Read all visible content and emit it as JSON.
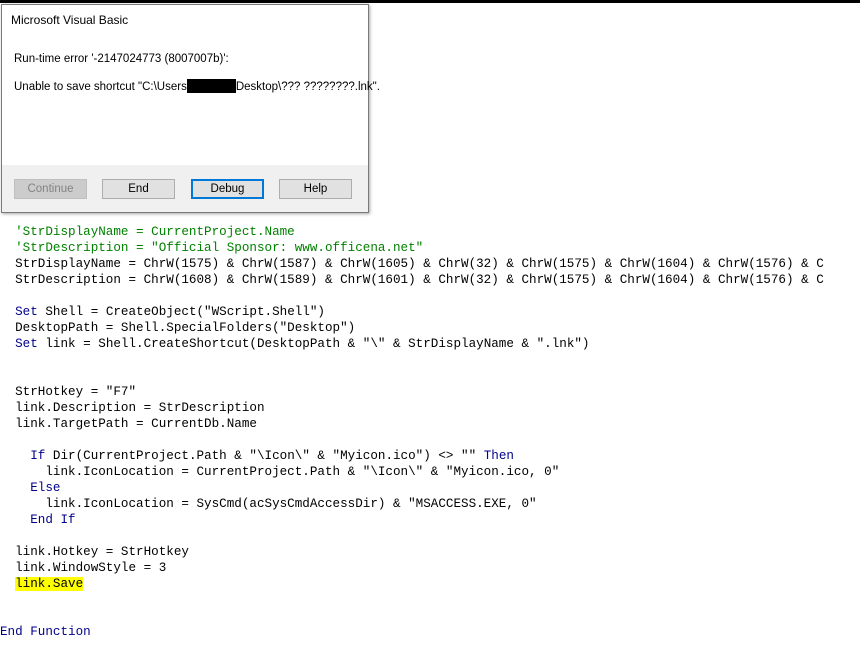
{
  "dialog": {
    "title": "Microsoft Visual Basic",
    "error_line": "Run-time error '-2147024773 (8007007b)':",
    "message_prefix": "Unable to save shortcut \"C:\\Users",
    "message_suffix": "Desktop\\??? ????????.lnk\".",
    "buttons": {
      "continue": "Continue",
      "end": "End",
      "debug": "Debug",
      "help": "Help"
    }
  },
  "code": {
    "lines": [
      "  'StrDisplayName = CurrentProject.Name",
      "  'StrDescription = \"Official Sponsor: www.officena.net\"",
      "  StrDisplayName = ChrW(1575) & ChrW(1587) & ChrW(1605) & ChrW(32) & ChrW(1575) & ChrW(1604) & ChrW(1576) & C",
      "  StrDescription = ChrW(1608) & ChrW(1589) & ChrW(1601) & ChrW(32) & ChrW(1575) & ChrW(1604) & ChrW(1576) & C",
      "",
      "  Set",
      " Shell = CreateObject(\"WScript.Shell\")",
      "  DesktopPath = Shell.SpecialFolders(\"Desktop\")",
      "  Set",
      " link = Shell.CreateShortcut(DesktopPath & \"\\\" & StrDisplayName & \".lnk\")",
      "",
      "",
      "  StrHotkey = \"F7\"",
      "  link.Description = StrDescription",
      "  link.TargetPath = CurrentDb.Name",
      "",
      "    If",
      " Dir(CurrentProject.Path & \"\\Icon\\\" & \"Myicon.ico\") <> \"\" ",
      "Then",
      "      link.IconLocation = CurrentProject.Path & \"\\Icon\\\" & \"Myicon.ico, 0\"",
      "    Else",
      "      link.IconLocation = SysCmd(acSysCmdAccessDir) & \"MSACCESS.EXE, 0\"",
      "    End If",
      "",
      "  link.Hotkey = StrHotkey",
      "  link.WindowStyle = 3",
      "  ",
      "link.Save",
      "",
      "",
      "End Function"
    ]
  },
  "colors": {
    "comment": "#008000",
    "keyword": "#00008b",
    "highlight": "#ffff00",
    "default_button_border": "#0078d7"
  }
}
